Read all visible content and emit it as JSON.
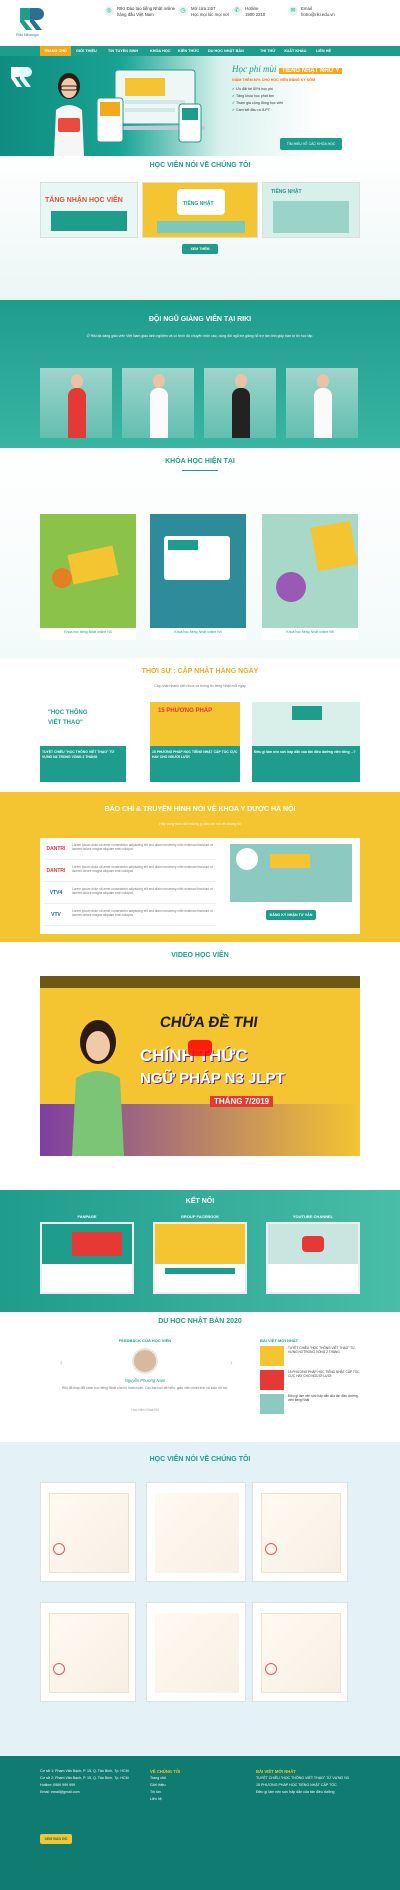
{
  "header": {
    "logo_text": "Riki Nihongo",
    "infos": [
      {
        "icon": "globe-icon",
        "text": "RIKI Đào tạo tiếng Nhật online\nhàng đầu Việt Nam"
      },
      {
        "icon": "clock-icon",
        "text": "Mở cửa 24/7\nHọc mọi lúc mọi nơi"
      },
      {
        "icon": "phone-icon",
        "text": "Hotline\n1900 2210"
      },
      {
        "icon": "mail-icon",
        "text": "Email\nhotro@riki.edu.vn"
      }
    ]
  },
  "nav": [
    {
      "label": "TRANG CHỦ"
    },
    {
      "label": "GIỚI THIỆU"
    },
    {
      "label": "TIN TUYỂN SINH"
    },
    {
      "label": "KHÓA HỌC"
    },
    {
      "label": "KIẾN THỨC"
    },
    {
      "label": "DU HỌC NHẬT BẢN"
    },
    {
      "label": "THI THỬ"
    },
    {
      "label": "XUẤT KHẨU"
    },
    {
      "label": "LIÊN HỆ"
    }
  ],
  "hero": {
    "title": "Học phí mùi",
    "title_badge": "TIẾNG NHẬT NHƯ Ý",
    "subtitle": "GIẢM THÊM 40% CHO HỌC VIÊN ĐĂNG KÝ SỚM",
    "bullets": [
      "Ưu đãi tới 50% học phí",
      "Tặng khóa học phát âm",
      "Tham gia cộng đồng học viên",
      "Cam kết đầu ra JLPT"
    ],
    "cta": "TÌM HIỂU VỀ CÁC KHÓA HỌC"
  },
  "testimonials": {
    "title": "HỌC VIÊN NÓI VỀ CHÚNG TÔI",
    "cards": [
      "TĂNG NHẬN HỌC VIÊN",
      "TIẾNG NHẬT",
      "TIẾNG NHẬT"
    ],
    "button": "XEM THÊM"
  },
  "teachers": {
    "title": "ĐỘI NGŨ GIẢNG VIÊN TẠI RIKI",
    "desc": "Ở Riki đa dạng giáo viên Việt Nam giàu kinh nghiệm và có trình độ chuyên môn cao, cùng đội ngũ trợ giảng hỗ trợ tận tình giúp bạn tự tin học tập."
  },
  "courses": {
    "title": "KHÓA HỌC HIỆN TẠI",
    "items": [
      {
        "label": "Khóa học tiếng Nhật online N3"
      },
      {
        "label": "Khóa học tiếng Nhật online N4"
      },
      {
        "label": "Khóa học tiếng Nhật online N5"
      }
    ]
  },
  "news": {
    "title": "THỜI SỰ : CẬP NHẬT HÀNG NGÀY",
    "desc": "Cập nhật nhanh kiến thức và thông tin tiếng Nhật mỗi ngày",
    "items": [
      {
        "caption": "TUYỆT CHIÊU \"HỌC THÔNG VIẾT THẠO\" TỪ VỰNG N3 TRONG VÒNG 2 THÁNG"
      },
      {
        "caption": "15 PHƯƠNG PHÁP HỌC TIẾNG NHẬT CẤP TỐC CỰC HAY CHO NGƯỜI LƯỜI"
      },
      {
        "caption": "Điều gì làm nên sức hấp dẫn của tân điều dưỡng viên tiếng ...?"
      }
    ]
  },
  "press": {
    "title": "BÁO CHÍ & TRUYỀN HÌNH NÓI VỀ KHOA Y DƯỢC HÀ NỘI",
    "desc": "Hãy cùng theo dõi những gì báo chí nói về chúng tôi",
    "rows": [
      {
        "logo": "DANTRI"
      },
      {
        "logo": "DANTRI"
      },
      {
        "logo": "VTV4"
      },
      {
        "logo": "VTV"
      }
    ],
    "sample_text": "Lorem ipsum dolor sit amet consectetur adipiscing elit sed diam nonummy nibh euismod tincidunt ut laoreet dolore magna aliquam erat volutpat.",
    "cta": "ĐĂNG KÝ NHẬN TƯ VẤN"
  },
  "video": {
    "title": "VIDEO HỌC VIÊN",
    "line1": "CHỮA ĐỀ THI",
    "line2": "CHÍNH THỨC",
    "line3": "NGỮ PHÁP N3 JLPT",
    "line4": "THÁNG 7/2019"
  },
  "connect": {
    "title": "KẾT NỐI",
    "cols": [
      {
        "label": "FANPAGE"
      },
      {
        "label": "GROUP FACEBOOK"
      },
      {
        "label": "YOUTUBE CHANNEL"
      }
    ]
  },
  "abroad": {
    "title": "DU HỌC NHẬT BẢN 2020",
    "left_head": "FEEDBACK CỦA HỌC VIÊN",
    "student_name": "Nguyễn Phương Nam",
    "quote": "Riki đã thay đổi cách học tiếng Nhật của tôi hoàn toàn. Các bài học dễ hiểu, giáo viên nhiệt tình và luôn hỗ trợ.",
    "student_role": "Học viên Khóa N3",
    "right_head": "BÀI VIẾT MỚI NHẤT",
    "posts": [
      "TUYỆT CHIÊU \"HỌC THÔNG VIẾT THẠO\" TỪ VỰNG N3 TRONG VÒNG 2 THÁNG",
      "15 PHƯƠNG PHÁP HỌC TIẾNG NHẬT CẤP TỐC CỰC HAY CHO NGƯỜI LƯỜI",
      "Điều gì làm nên sức hấp dẫn của tân điều dưỡng viên tiếng Nhật"
    ]
  },
  "letters": {
    "title": "HỌC VIÊN NÓI VỀ CHÚNG TÔI"
  },
  "footer": {
    "addr": [
      "Cơ sở 1: Phạm Văn Bạch, P. 15, Q. Tân Bình, Tp. HCM",
      "Cơ sở 2: Phạm Văn Bạch, P. 15, Q. Tân Bình, Tp. HCM",
      "Hotline: 0989 999 999",
      "Email: email@gmail.com"
    ],
    "cta": "XEM BẢN ĐỒ",
    "col2_head": "VỀ CHÚNG TÔI",
    "col2": [
      "Trang chủ",
      "Giới thiệu",
      "Tin tức",
      "Liên hệ"
    ],
    "col3_head": "BÀI VIẾT MỚI NHẤT",
    "col3": [
      "TUYỆT CHIÊU \"HỌC THÔNG VIẾT THẠO\" TỪ VỰNG N3",
      "15 PHƯƠNG PHÁP HỌC TIẾNG NHẬT CẤP TỐC",
      "Điều gì làm nên sức hấp dẫn của tân điều dưỡng"
    ]
  }
}
